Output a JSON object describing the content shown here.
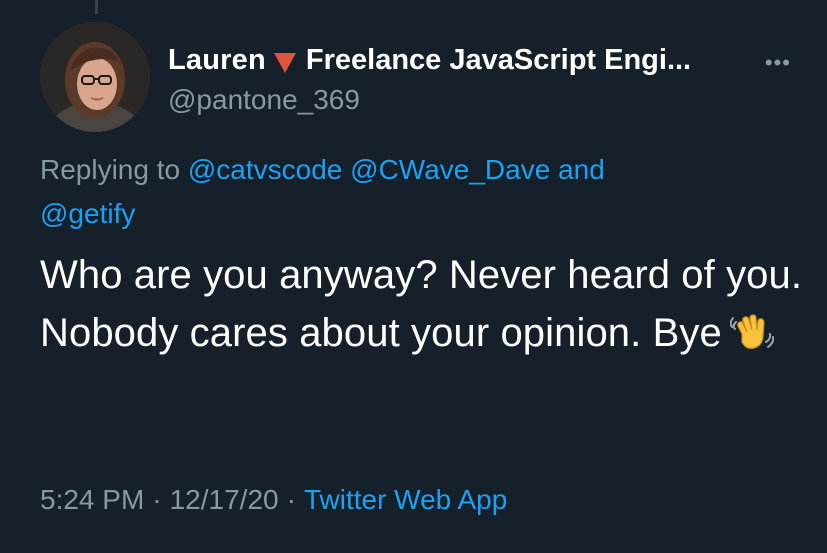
{
  "tweet": {
    "author": {
      "display_name": "Lauren",
      "name_suffix": "Freelance JavaScript Engi...",
      "handle": "@pantone_369",
      "flag_icon": "red-triangle-icon",
      "flag_color": "#e0533d"
    },
    "more_icon": "more-horizontal-icon",
    "replying": {
      "prefix": "Replying to",
      "mention_1": "@catvscode",
      "mention_2": "@CWave_Dave",
      "conjunction": "and",
      "mention_3": "@getify"
    },
    "text": "Who are you anyway? Never heard of you. Nobody cares about your opinion. Bye",
    "emoji_icon": "waving-hand-icon",
    "meta": {
      "time": "5:24 PM",
      "separator": "·",
      "date": "12/17/20",
      "source": "Twitter Web App"
    }
  },
  "colors": {
    "background": "#15202b",
    "text_primary": "#ffffff",
    "text_secondary": "#8899a6",
    "accent": "#1da1f2"
  }
}
